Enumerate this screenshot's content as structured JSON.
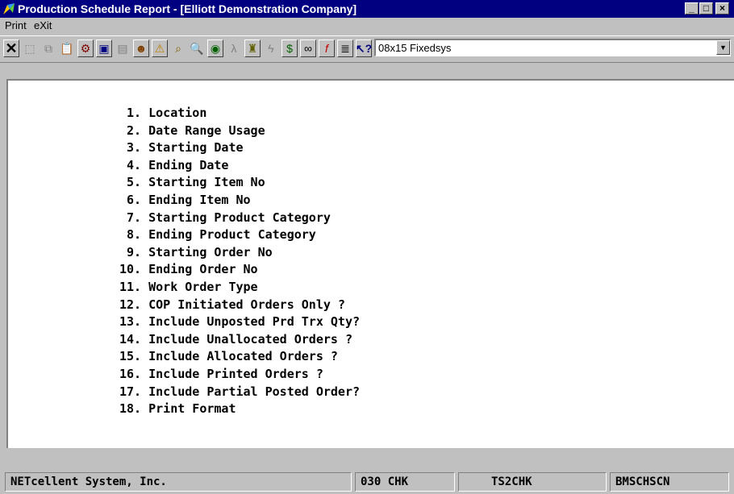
{
  "window": {
    "title": "Production Schedule Report - [Elliott Demonstration Company]",
    "minimize": "_",
    "maximize": "□",
    "close": "×"
  },
  "menubar": {
    "items": [
      "Print",
      "eXit"
    ]
  },
  "toolbar": {
    "font_select_value": "08x15 Fixedsys",
    "icons": [
      "close-x",
      "select",
      "copy",
      "paste",
      "settings",
      "properties",
      "note",
      "user",
      "alert",
      "search",
      "zoom",
      "globe",
      "lambda",
      "person",
      "lightning",
      "dollar",
      "link",
      "function",
      "list",
      "help"
    ]
  },
  "report_menu": {
    "items": [
      " 1. Location",
      " 2. Date Range Usage",
      " 3. Starting Date",
      " 4. Ending Date",
      " 5. Starting Item No",
      " 6. Ending Item No",
      " 7. Starting Product Category",
      " 8. Ending Product Category",
      " 9. Starting Order No",
      "10. Ending Order No",
      "11. Work Order Type",
      "12. COP Initiated Orders Only ?",
      "13. Include Unposted Prd Trx Qty?",
      "14. Include Unallocated Orders ?",
      "15. Include Allocated Orders ?",
      "16. Include Printed Orders ?",
      "17. Include Partial Posted Order?",
      "18. Print Format"
    ]
  },
  "status_bar": {
    "company": "NETcellent System, Inc.",
    "code": "030 CHK",
    "user": "TS2CHK",
    "program": "BMSCHSCN"
  },
  "colors": {
    "titlebar": "#000080",
    "face": "#c0c0c0",
    "workarea": "#ffffff"
  }
}
